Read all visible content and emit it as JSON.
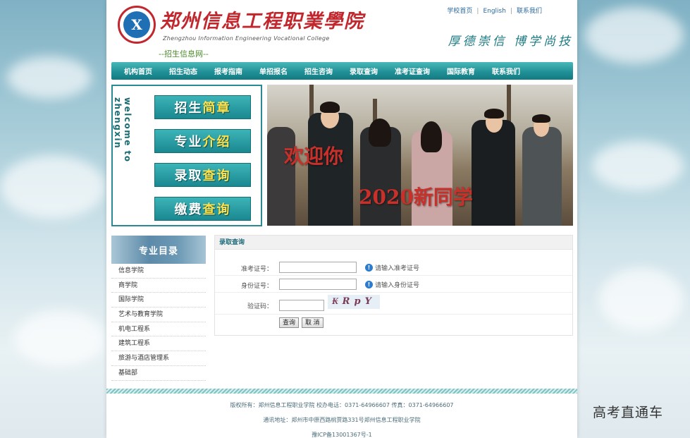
{
  "header": {
    "school_cn": "郑州信息工程职業學院",
    "school_en": "Zhengzhou Information Engineering Vocational College",
    "site_sub": "--招生信息网--",
    "top_links": [
      "学校首页",
      "English",
      "联系我们"
    ],
    "motto": "厚德崇信 博学尚技",
    "logo_text": "X"
  },
  "nav": {
    "items": [
      "机构首页",
      "招生动态",
      "报考指南",
      "单招报名",
      "招生咨询",
      "录取查询",
      "准考证查询",
      "国际教育",
      "联系我们"
    ]
  },
  "quick": {
    "welcome": "welcome to zhengxin",
    "buttons": [
      {
        "a": "招生",
        "b": "简章"
      },
      {
        "a": "专业",
        "b": "介绍"
      },
      {
        "a": "录取",
        "b": "查询"
      },
      {
        "a": "缴费",
        "b": "查询"
      }
    ]
  },
  "banner": {
    "line1": "欢迎你",
    "line2": "2020新同学"
  },
  "sidebar": {
    "title": "专业目录",
    "items": [
      "信息学院",
      "商学院",
      "国际学院",
      "艺术与教育学院",
      "机电工程系",
      "建筑工程系",
      "旅游与酒店管理系",
      "基础部"
    ]
  },
  "query": {
    "title": "录取查询",
    "exam_label": "准考证号：",
    "exam_hint": "请输入准考证号",
    "id_label": "身份证号：",
    "id_hint": "请输入身份证号",
    "captcha_label": "验证码：",
    "captcha_text": "₭RpY",
    "submit": "查询",
    "cancel": "取 消"
  },
  "footer": {
    "line1": "版权所有：郑州信息工程职业学院 校办电话：0371-64966607 传真：0371-64966607",
    "line2": "通讯地址：郑州市中原西路桃贾路331号郑州信息工程职业学院",
    "line3": "豫ICP备13001367号-1"
  },
  "watermark": "高考直通车"
}
